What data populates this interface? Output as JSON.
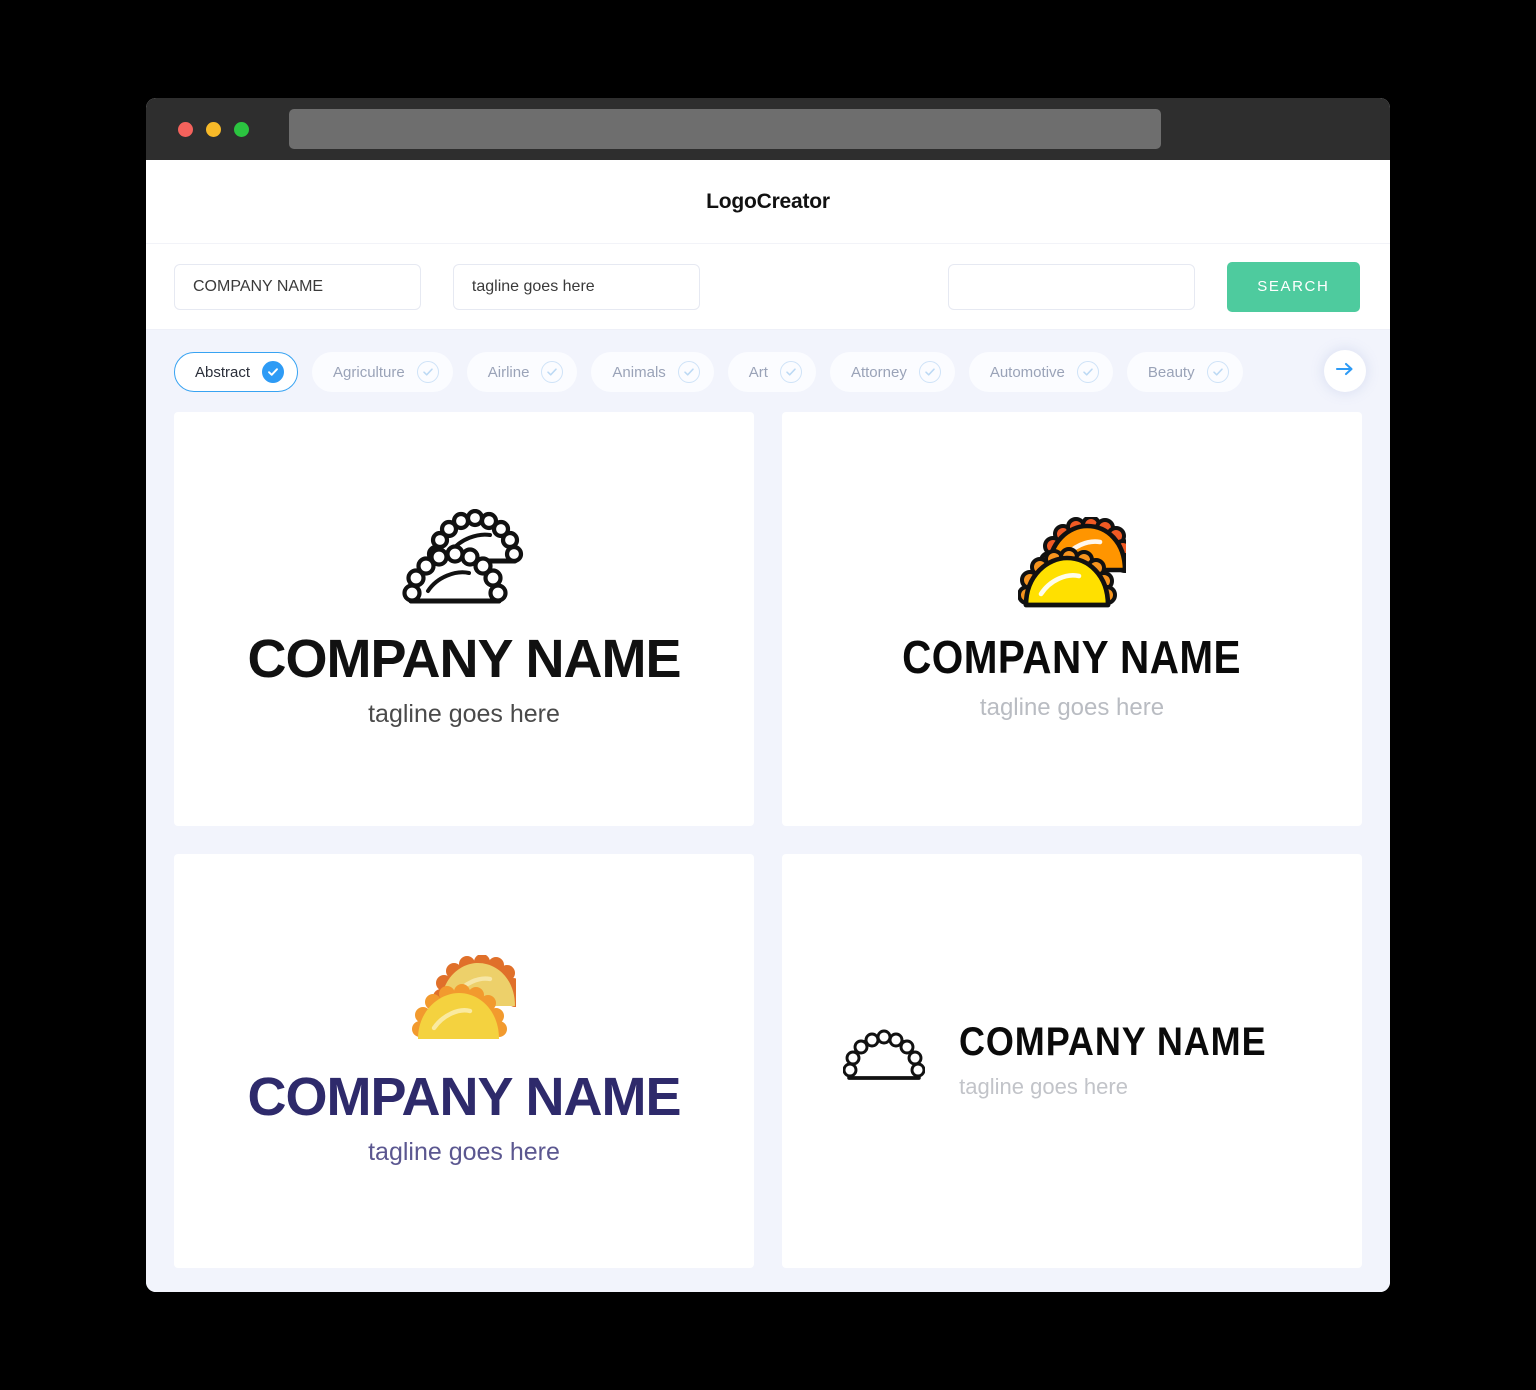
{
  "window": {
    "traffic_lights": [
      "close",
      "minimize",
      "maximize"
    ],
    "url_value": ""
  },
  "header": {
    "title": "LogoCreator"
  },
  "search": {
    "company_value": "COMPANY NAME",
    "tagline_value": "tagline goes here",
    "extra_value": "",
    "button_label": "SEARCH"
  },
  "chips": {
    "items": [
      {
        "label": "Abstract",
        "active": true
      },
      {
        "label": "Agriculture",
        "active": false
      },
      {
        "label": "Airline",
        "active": false
      },
      {
        "label": "Animals",
        "active": false
      },
      {
        "label": "Art",
        "active": false
      },
      {
        "label": "Attorney",
        "active": false
      },
      {
        "label": "Automotive",
        "active": false
      },
      {
        "label": "Beauty",
        "active": false
      }
    ],
    "next_icon": "arrow-right-icon"
  },
  "results": {
    "cards": [
      {
        "name": "COMPANY NAME",
        "tagline": "tagline goes here",
        "mark": "empanada-pair-outline-icon",
        "layout": "stacked"
      },
      {
        "name": "COMPANY NAME",
        "tagline": "tagline goes here",
        "mark": "empanada-pair-color-outline-icon",
        "layout": "stacked"
      },
      {
        "name": "COMPANY NAME",
        "tagline": "tagline goes here",
        "mark": "empanada-pair-flat-icon",
        "layout": "stacked"
      },
      {
        "name": "COMPANY NAME",
        "tagline": "tagline goes here",
        "mark": "empanada-single-outline-icon",
        "layout": "horizontal"
      }
    ]
  },
  "colors": {
    "accent_green": "#4ecb9e",
    "accent_blue": "#2e9bf5",
    "page_background": "#f2f4fc",
    "titlebar": "#2e2e2e",
    "navy": "#2e2a6b",
    "empanada_back_body": "#ff9500",
    "empanada_back_crimp": "#f15a24",
    "empanada_front_body": "#ffe000",
    "empanada_front_crimp": "#f7941e",
    "traffic_red": "#f4625c",
    "traffic_yellow": "#f7b928",
    "traffic_green": "#2bc440"
  }
}
